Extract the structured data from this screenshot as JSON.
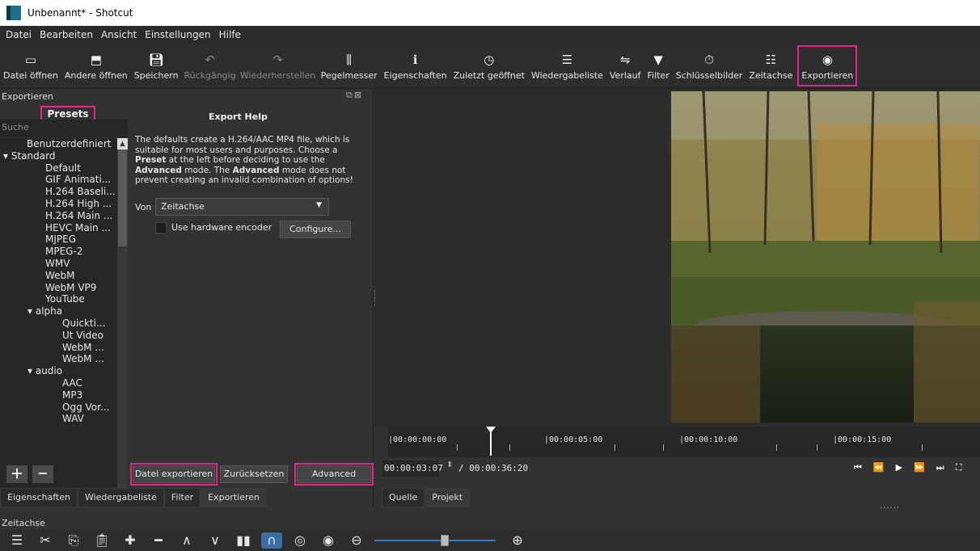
{
  "window": {
    "title": "Unbenannt* - Shotcut"
  },
  "menu": {
    "items": [
      {
        "label": "Datei"
      },
      {
        "label": "Bearbeiten"
      },
      {
        "label": "Ansicht"
      },
      {
        "label": "Einstellungen"
      },
      {
        "label": "Hilfe"
      }
    ]
  },
  "toolbar": {
    "open_file": "Datei öffnen",
    "open_other": "Andere öffnen",
    "save": "Speichern",
    "undo": "Rückgängig",
    "redo": "Wiederherstellen",
    "peak_meter": "Pegelmesser",
    "properties": "Eigenschaften",
    "recent": "Zuletzt geöffnet",
    "playlist": "Wiedergabeliste",
    "history": "Verlauf",
    "filter": "Filter",
    "keyframes": "Schlüsselbilder",
    "timeline": "Zeitachse",
    "export": "Exportieren"
  },
  "export_panel": {
    "dock_title": "Exportieren",
    "presets_heading": "Presets",
    "search_placeholder": "Suche",
    "presets": [
      "Benutzerdefiniert",
      "Standard",
      "Default",
      "GIF Animati...",
      "H.264 Baseli...",
      "H.264 High ...",
      "H.264 Main ...",
      "HEVC Main ...",
      "MJPEG",
      "MPEG-2",
      "WMV",
      "WebM",
      "WebM VP9",
      "YouTube",
      "alpha",
      "Quickti...",
      "Ut Video",
      "WebM ...",
      "WebM ...",
      "audio",
      "AAC",
      "MP3",
      "Ogg Vor...",
      "WAV"
    ],
    "help_title": "Export Help",
    "help_line1": "The defaults create a H.264/AAC MP4 file, which is",
    "help_line2": "suitable for most users and purposes. Choose a",
    "help_line3_bold": "Preset",
    "help_line3_rest": " at the left before deciding to use the",
    "help_line4_bold1": "Advanced",
    "help_line4_mid": " mode. The ",
    "help_line4_bold2": "Advanced",
    "help_line4_rest": " mode does not",
    "help_line5": "prevent creating an invalid combination of options!",
    "from_label": "Von",
    "from_value": "Zeitachse",
    "hw_encoder_label": "Use hardware encoder",
    "configure_button": "Configure...",
    "export_file_button": "Datei exportieren",
    "reset_button": "Zurücksetzen",
    "advanced_button": "Advanced"
  },
  "left_tabs": [
    "Eigenschaften",
    "Wiedergabeliste",
    "Filter",
    "Exportieren"
  ],
  "right_tabs": [
    "Quelle",
    "Projekt"
  ],
  "player": {
    "ruler_labels": [
      "|00:00:00:00",
      "|00:00:05:00",
      "|00:00:10:00",
      "|00:00:15:00"
    ],
    "current_time": "00:00:03:07",
    "duration": "/ 00:00:36:20"
  },
  "timeline": {
    "label": "Zeitachse",
    "zoom_level": 0.55
  }
}
